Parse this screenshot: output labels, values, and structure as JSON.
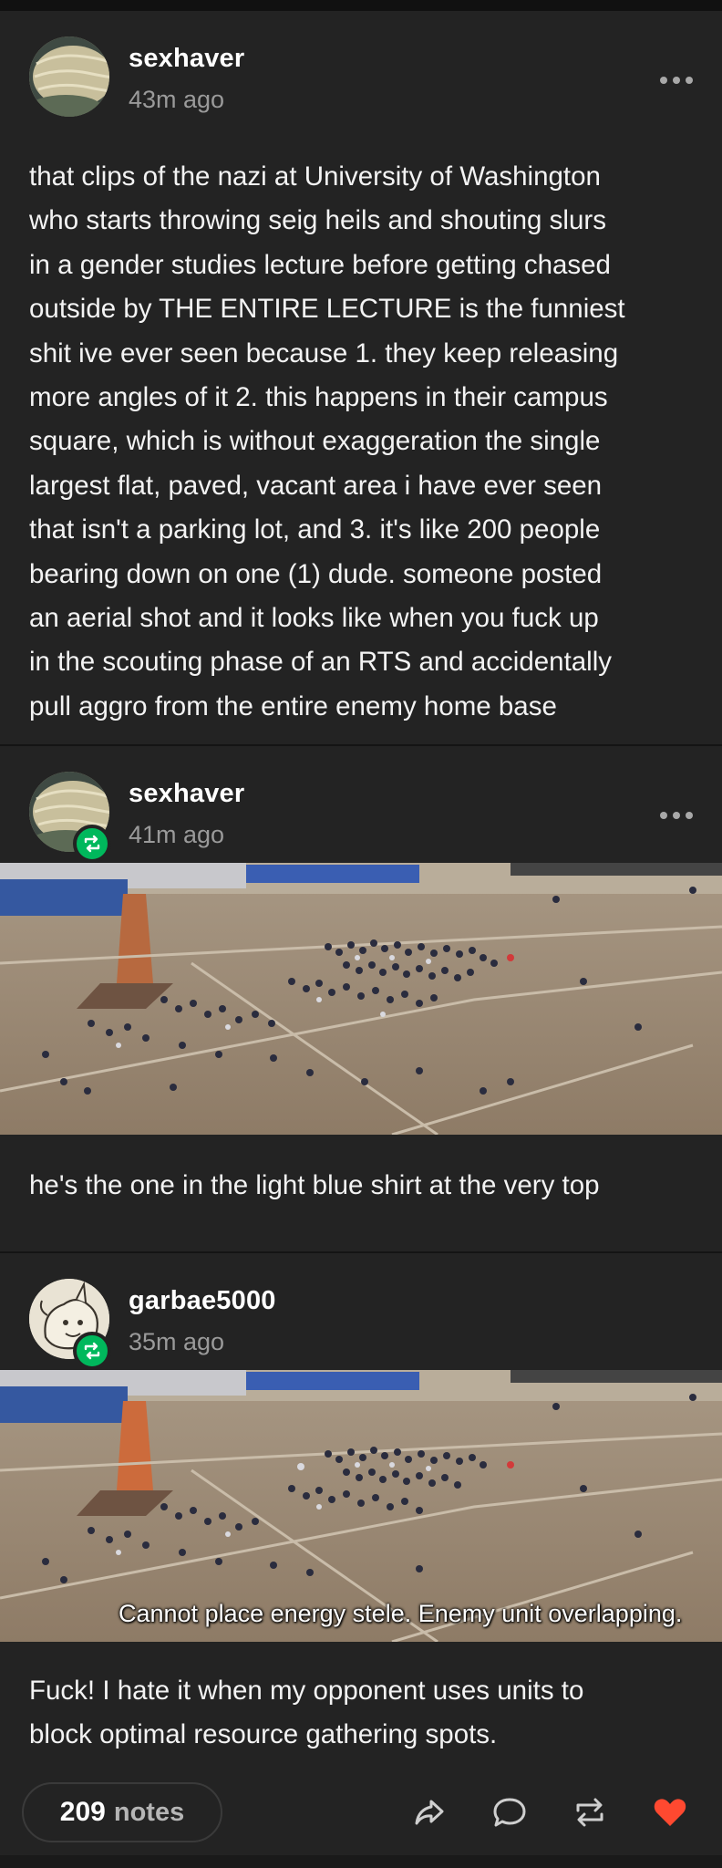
{
  "posts": [
    {
      "username": "sexhaver",
      "timestamp": "43m ago",
      "lines": [
        "that clips of the nazi at University of Washington",
        "who starts throwing seig heils and shouting slurs",
        "in a gender studies lecture before getting chased",
        "outside by THE ENTIRE LECTURE is the funniest",
        "shit ive ever seen because 1. they keep releasing",
        "more angles of it 2. this happens in their campus",
        "square, which is without exaggeration the single",
        "largest flat, paved, vacant area i have ever seen",
        "that isn't a parking lot, and 3. it's like 200 people",
        "bearing down on one (1) dude. someone posted",
        "an aerial shot and it looks like when you fuck up",
        "in the scouting phase of an RTS and accidentally",
        "pull aggro from the entire enemy home base"
      ]
    },
    {
      "username": "sexhaver",
      "timestamp": "41m ago",
      "text": "he's the one in the light blue shirt at the very top"
    },
    {
      "username": "garbae5000",
      "timestamp": "35m ago",
      "image_caption": "Cannot place energy stele. Enemy unit overlapping.",
      "lines": [
        "Fuck! I hate it when my opponent uses units to",
        "block optimal resource gathering spots."
      ]
    }
  ],
  "footer": {
    "notes_count": "209",
    "notes_label": "notes",
    "like_color": "#ff4930"
  },
  "icons": [
    "more-icon",
    "reblog-icon",
    "share-icon",
    "reply-icon",
    "heart-icon"
  ],
  "colors": {
    "background": "#232323",
    "reblog_badge": "#00b85c",
    "muted_text": "#9a9a9a"
  }
}
